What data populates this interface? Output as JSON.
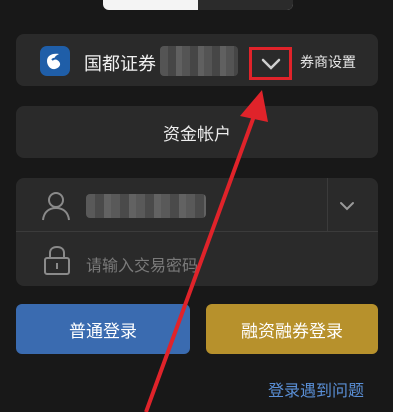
{
  "broker": {
    "name": "国都证券",
    "settings_label": "券商设置"
  },
  "account": {
    "label": "资金帐户"
  },
  "login": {
    "password_placeholder": "请输入交易密码"
  },
  "buttons": {
    "normal_login": "普通登录",
    "margin_login": "融资融券登录"
  },
  "help": {
    "label": "登录遇到问题"
  },
  "colors": {
    "background": "#181818",
    "card": "#2a2a2a",
    "normal_button": "#3a6bb0",
    "margin_button": "#b7912c",
    "link": "#5a8fd6",
    "annotation": "#e0232a"
  },
  "icons": [
    "broker-logo-icon",
    "chevron-down-icon",
    "user-icon",
    "lock-icon",
    "annotation-arrow"
  ]
}
